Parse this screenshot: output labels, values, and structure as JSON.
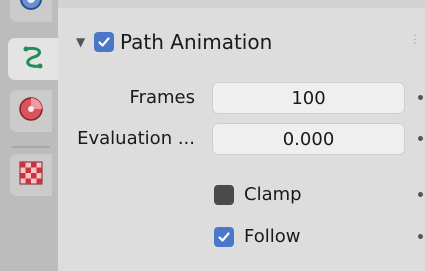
{
  "tabs": [
    {
      "icon": "physics-circle-icon",
      "active": false
    },
    {
      "icon": "curve-data-icon",
      "active": true
    },
    {
      "icon": "material-sphere-icon",
      "active": false
    },
    {
      "icon": "texture-checker-icon",
      "active": false
    }
  ],
  "panel": {
    "title": "Path Animation",
    "enabled": true,
    "fields": [
      {
        "label": "Frames",
        "value": "100"
      },
      {
        "label": "Evaluation ...",
        "value": "0.000"
      }
    ],
    "toggles": [
      {
        "label": "Clamp",
        "checked": false
      },
      {
        "label": "Follow",
        "checked": true
      }
    ]
  },
  "colors": {
    "checkbox_on": "#4a77c8",
    "checkbox_off": "#4a4a4a",
    "curve_icon": "#1f8f5a",
    "material_icon": "#c8333e"
  }
}
